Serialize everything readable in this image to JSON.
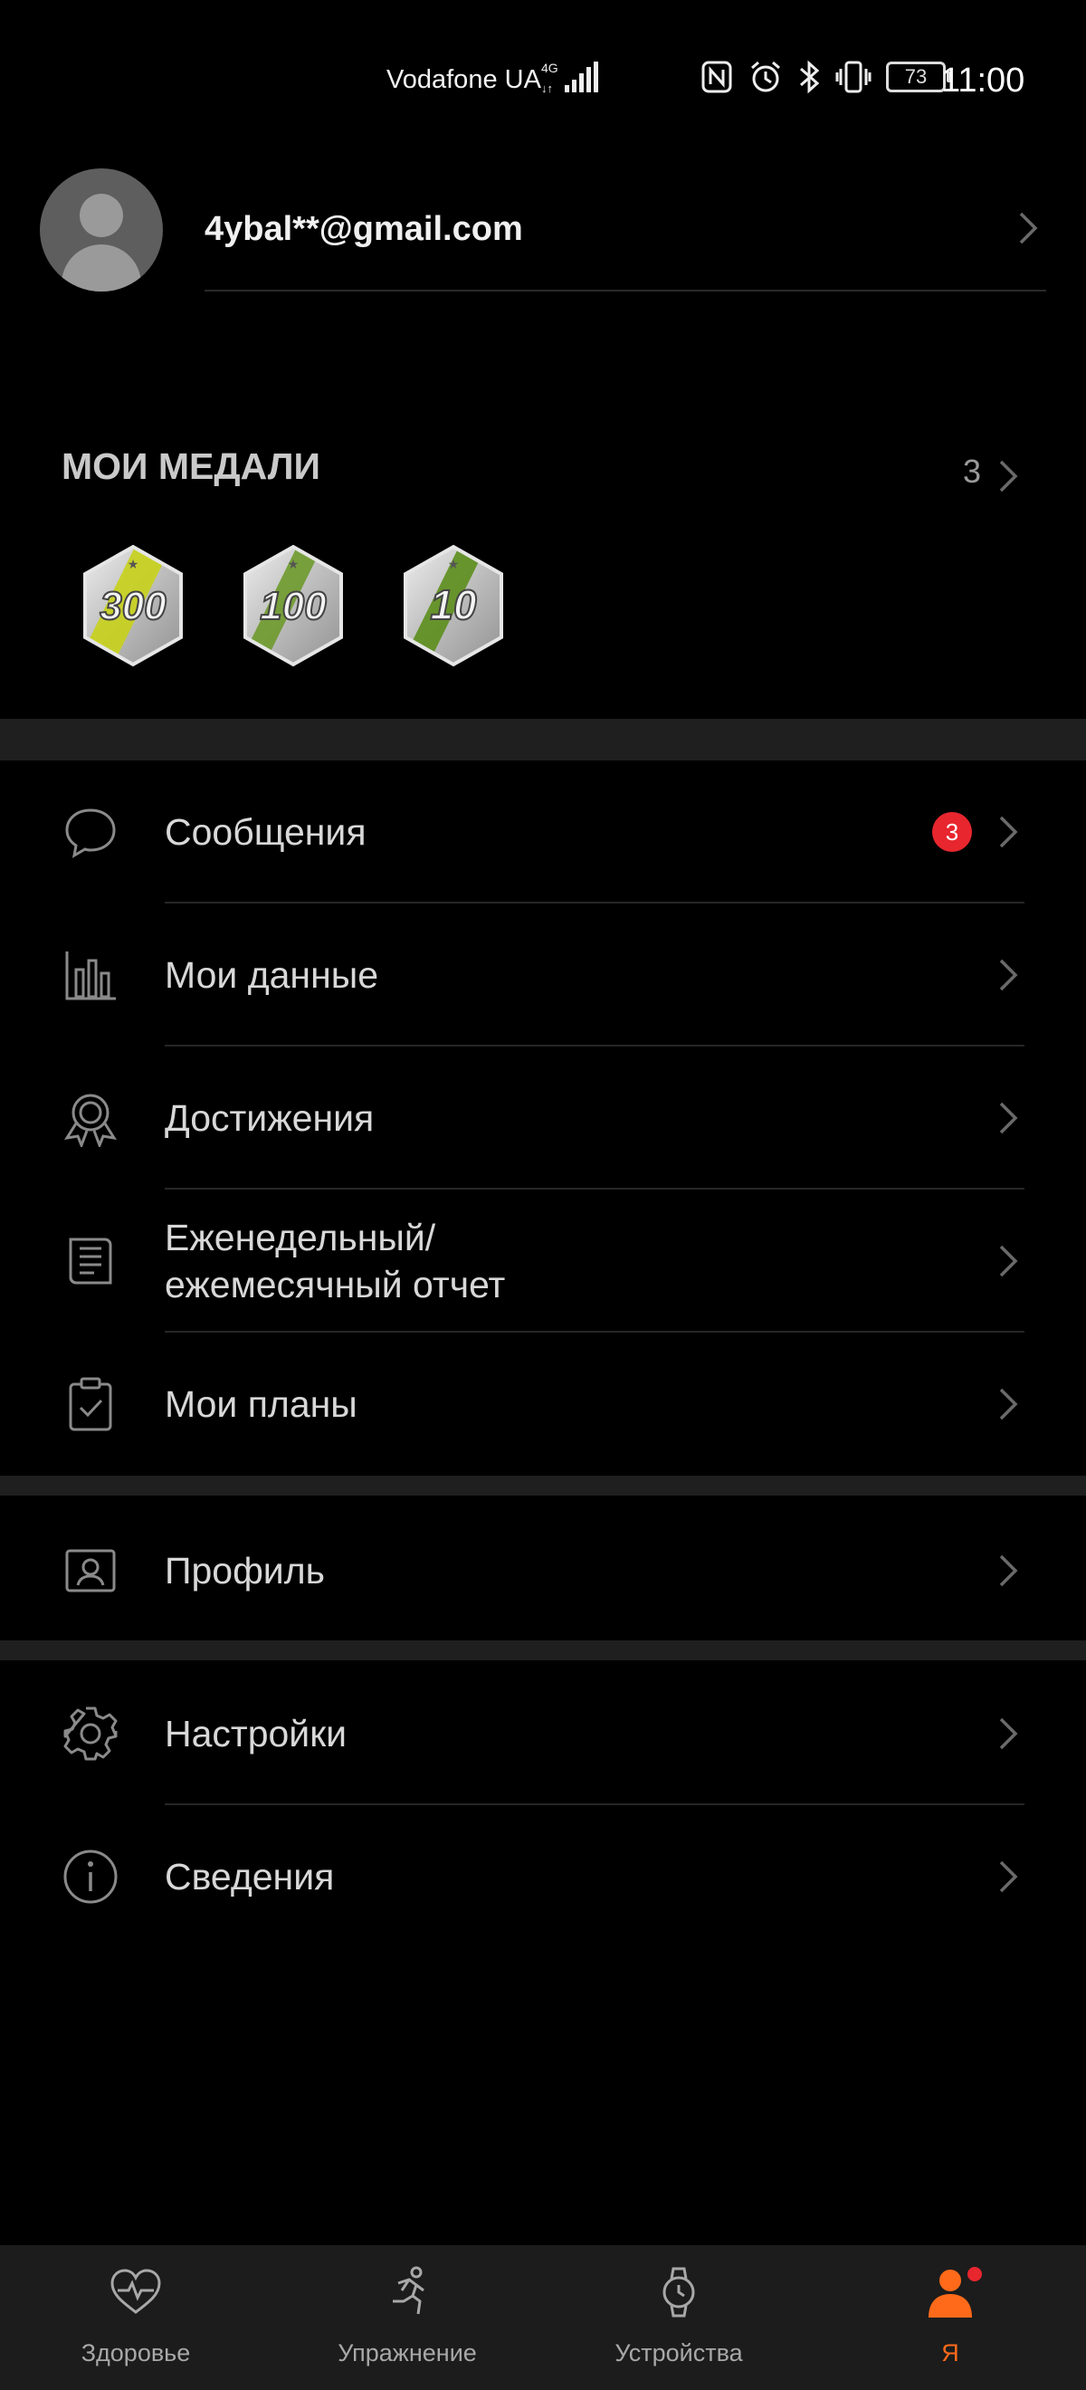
{
  "status_bar": {
    "carrier": "Vodafone UA",
    "network": "4G",
    "battery": "73",
    "time": "11:00",
    "icons": [
      "nfc-icon",
      "alarm-icon",
      "bluetooth-icon",
      "vibrate-icon",
      "battery-icon"
    ]
  },
  "account": {
    "email": "4ybal**@gmail.com"
  },
  "medals": {
    "title": "МОИ МЕДАЛИ",
    "count": "3",
    "items": [
      {
        "label": "300",
        "stripe_color": "#c8d21a"
      },
      {
        "label": "100",
        "stripe_color": "#6e9a2c"
      },
      {
        "label": "10",
        "stripe_color": "#5c8e1c"
      }
    ]
  },
  "menu": {
    "messages": {
      "label": "Сообщения",
      "badge": "3",
      "icon": "chat-bubble-icon"
    },
    "my_data": {
      "label": "Мои данные",
      "icon": "bar-chart-icon"
    },
    "achievements": {
      "label": "Достижения",
      "icon": "award-icon"
    },
    "reports": {
      "label_line1": "Еженедельный/",
      "label_line2": "ежемесячный отчет",
      "icon": "report-icon"
    },
    "plans": {
      "label": "Мои планы",
      "icon": "clipboard-check-icon"
    },
    "profile": {
      "label": "Профиль",
      "icon": "profile-card-icon"
    },
    "settings": {
      "label": "Настройки",
      "icon": "gear-icon"
    },
    "info": {
      "label": "Сведения",
      "icon": "info-icon"
    }
  },
  "bottom_nav": {
    "tabs": [
      {
        "label": "Здоровье",
        "icon": "heart-pulse-icon"
      },
      {
        "label": "Упражнение",
        "icon": "runner-icon"
      },
      {
        "label": "Устройства",
        "icon": "watch-icon"
      },
      {
        "label": "Я",
        "icon": "person-icon"
      }
    ],
    "active_color": "#ff6a1a",
    "notification_color": "#e8262e"
  }
}
